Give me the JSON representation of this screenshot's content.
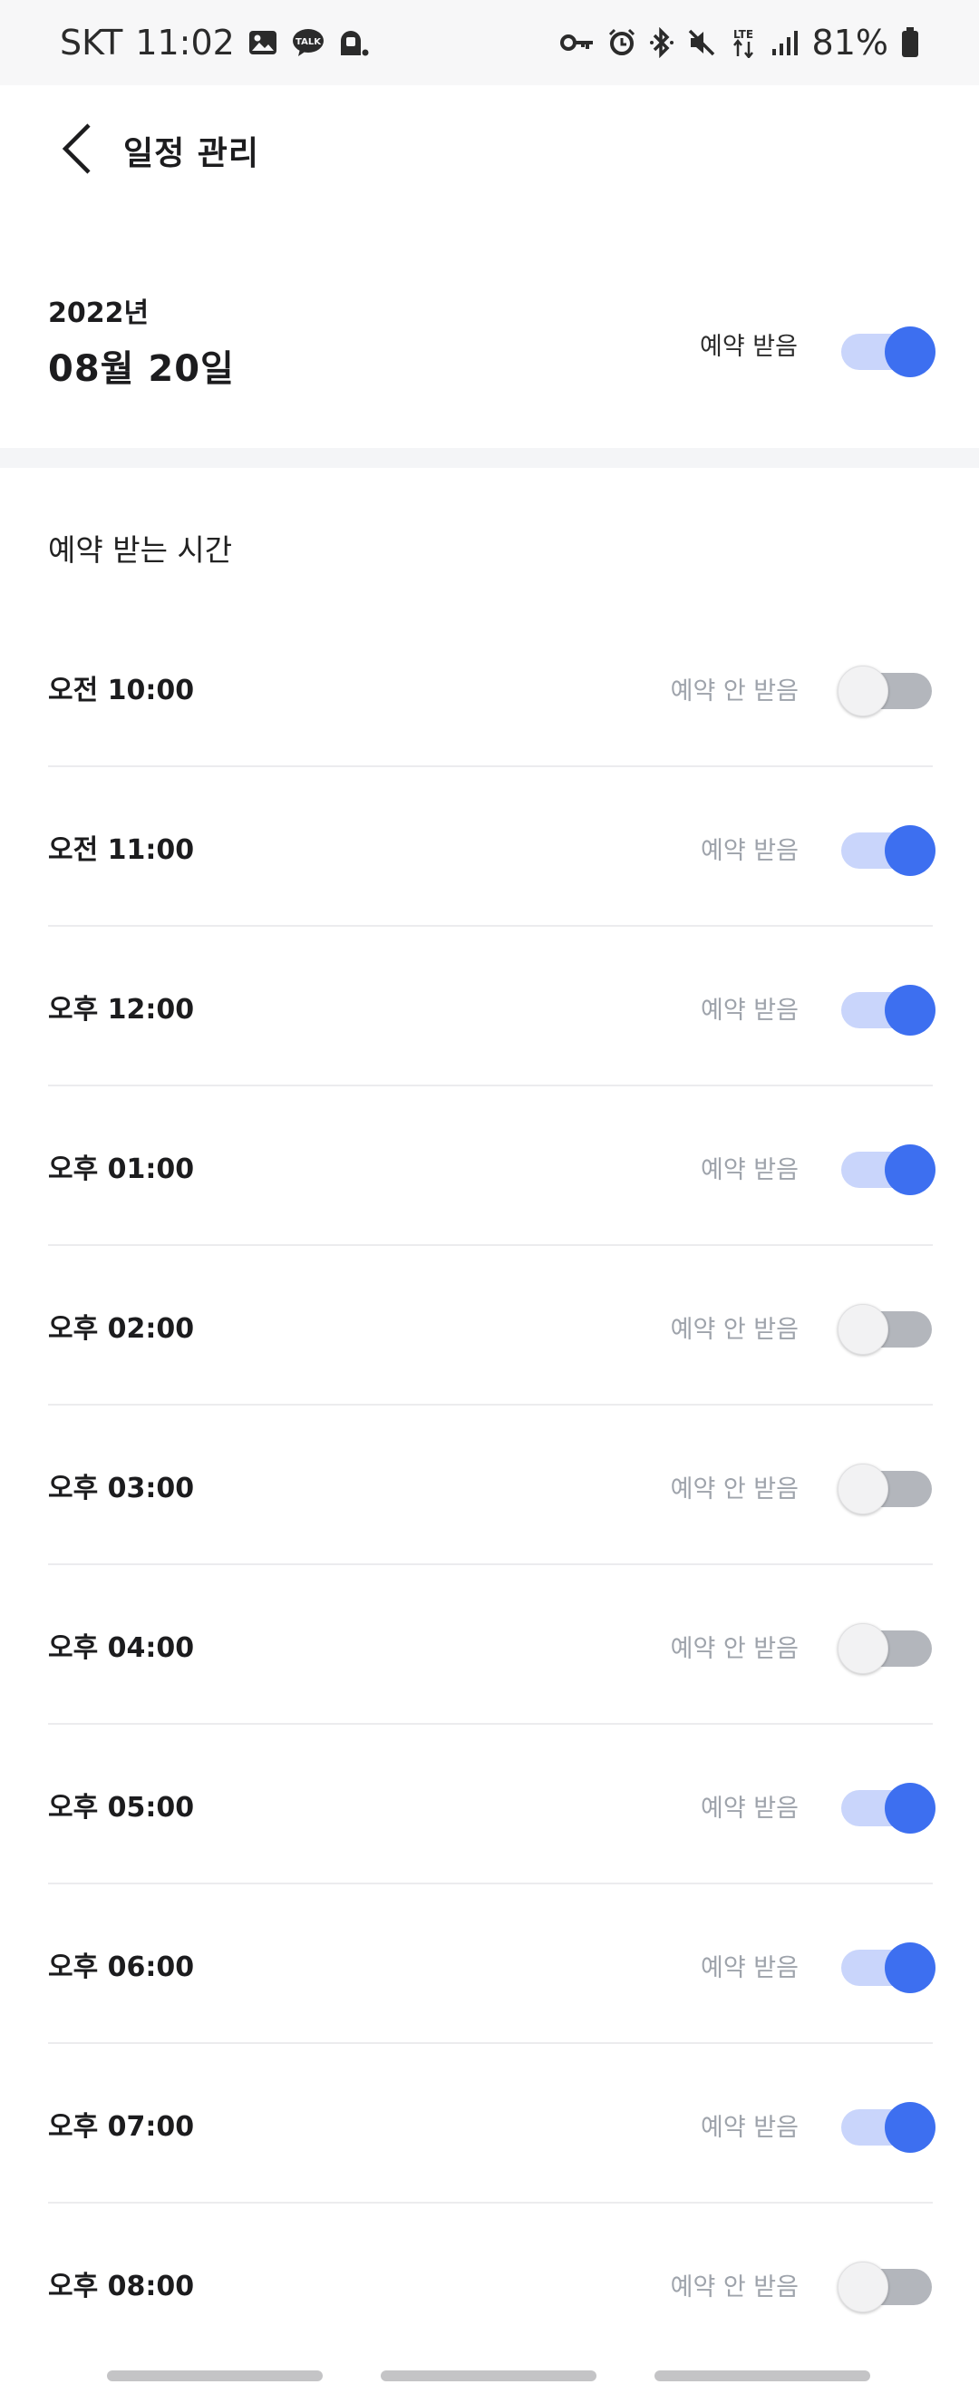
{
  "status_bar": {
    "carrier": "SKT",
    "time": "11:02",
    "talk_badge": "TALK",
    "network": "LTE",
    "battery": "81%"
  },
  "header": {
    "title": "일정 관리"
  },
  "date_block": {
    "year": "2022년",
    "day": "08월 20일",
    "status": "예약 받음",
    "accepting": true
  },
  "section": {
    "title": "예약 받는 시간"
  },
  "slots": [
    {
      "time": "오전 10:00",
      "status": "예약 안 받음",
      "on": false
    },
    {
      "time": "오전 11:00",
      "status": "예약 받음",
      "on": true
    },
    {
      "time": "오후 12:00",
      "status": "예약 받음",
      "on": true
    },
    {
      "time": "오후 01:00",
      "status": "예약 받음",
      "on": true
    },
    {
      "time": "오후 02:00",
      "status": "예약 안 받음",
      "on": false
    },
    {
      "time": "오후 03:00",
      "status": "예약 안 받음",
      "on": false
    },
    {
      "time": "오후 04:00",
      "status": "예약 안 받음",
      "on": false
    },
    {
      "time": "오후 05:00",
      "status": "예약 받음",
      "on": true
    },
    {
      "time": "오후 06:00",
      "status": "예약 받음",
      "on": true
    },
    {
      "time": "오후 07:00",
      "status": "예약 받음",
      "on": true
    },
    {
      "time": "오후 08:00",
      "status": "예약 안 받음",
      "on": false
    }
  ],
  "colors": {
    "accent": "#3d6ff0",
    "accent_track": "#c9d5fb",
    "off_track": "#b3b6bc",
    "muted_text": "#9ea3ab"
  },
  "icons": {
    "status_left": [
      "gallery-icon",
      "kakaotalk-icon",
      "app-notification-icon"
    ],
    "status_right": [
      "vpn-key-icon",
      "alarm-icon",
      "bluetooth-icon",
      "mute-icon",
      "lte-icon",
      "signal-icon",
      "battery-icon"
    ],
    "back": "back-arrow-icon"
  }
}
